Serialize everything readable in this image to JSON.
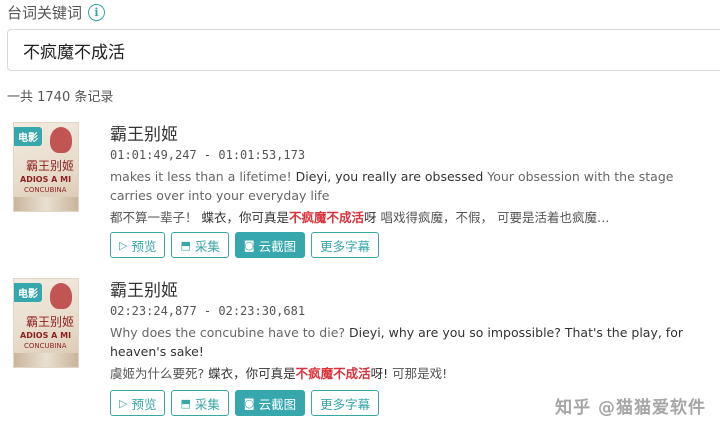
{
  "filter": {
    "label": "台词关键词",
    "info_icon": "i"
  },
  "search": {
    "value": "不疯魔不成活"
  },
  "results_count": "一共 1740 条记录",
  "results": [
    {
      "tag": "电影",
      "poster_title_cn": "霸王别姬",
      "poster_title_en": "ADIOS A MI",
      "poster_title_en2": "CONCUBINA",
      "title": "霸王别姬",
      "time": "01:01:49,247 - 01:01:53,173",
      "en_parts": [
        "makes it less than a lifetime!",
        "Dieyi, you really are obsessed",
        "Your obsession with the stage carries over into your everyday life"
      ],
      "cn_before": "都不算一辈子！",
      "cn_mid": "蝶衣，你可真是",
      "cn_kw": "不疯魔不成活",
      "cn_after": "呀",
      "cn_rest": "唱戏得疯魔，不假， 可要是活着也疯魔…"
    },
    {
      "tag": "电影",
      "poster_title_cn": "霸王别姬",
      "poster_title_en": "ADIOS A MI",
      "poster_title_en2": "CONCUBINA",
      "title": "霸王别姬",
      "time": "02:23:24,877 - 02:23:30,681",
      "en_parts": [
        "Why does the concubine have to die?",
        "Dieyi, why are you so impossible?",
        "That's the play, for heaven's sake!"
      ],
      "cn_before": "虞姬为什么要死?",
      "cn_mid": "蝶衣，你可真是",
      "cn_kw": "不疯魔不成活",
      "cn_after": "呀!",
      "cn_rest": "可那是戏!"
    }
  ],
  "buttons": {
    "preview": "预览",
    "collect": "采集",
    "screenshot": "云截图",
    "more": "更多字幕"
  },
  "watermark": "知乎 @猫猫爱软件",
  "colors": {
    "accent": "#36a7ad",
    "keyword": "#d9343c"
  }
}
